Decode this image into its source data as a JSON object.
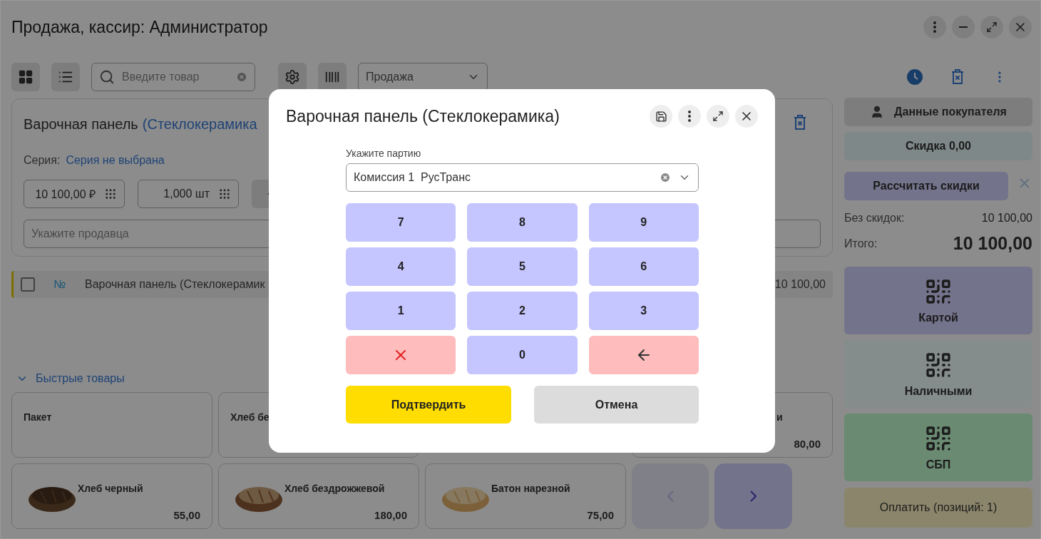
{
  "window": {
    "title": "Продажа, кассир: Администратор"
  },
  "toolbar": {
    "search": {
      "placeholder": "Введите товар"
    },
    "mode_select": {
      "value": "Продажа"
    }
  },
  "item_card": {
    "title": "Варочная панель",
    "title_detail": "(Стеклокерамика",
    "series_label": "Серия:",
    "series_value": "Серия не выбрана",
    "price": "10 100,00 ₽",
    "quantity": "1,000 шт",
    "seller": {
      "placeholder": "Укажите продавца"
    }
  },
  "cart_rows": [
    {
      "checked": false,
      "number": "№",
      "name": "Варочная панель (Стеклокерамик",
      "amount": "10 100,00"
    }
  ],
  "quick_products": {
    "title": "Быстрые товары",
    "expanded": true,
    "items": [
      {
        "kind": "text",
        "name": "Пакет"
      },
      {
        "kind": "text",
        "name": "Хлеб бе"
      },
      {
        "kind": "clipped",
        "name": "и",
        "price": "80,00"
      },
      {
        "kind": "picture",
        "name": "Хлеб черный",
        "price": "55,00"
      },
      {
        "kind": "picture",
        "name": "Хлеб бездрожжевой",
        "price": "180,00"
      },
      {
        "kind": "picture",
        "name": "Батон нарезной",
        "price": "75,00"
      }
    ],
    "nav": [
      {
        "kind": "prev",
        "disabled": true
      },
      {
        "kind": "next",
        "disabled": false
      }
    ]
  },
  "sidebar": {
    "customer_button": "Данные покупателя",
    "discount": "Скидка 0,00",
    "calc_button": "Рассчитать скидки",
    "totals": [
      {
        "kind": "normal",
        "label": "Без скидок:",
        "value": "10 100,00"
      },
      {
        "kind": "total",
        "label": "Итого:",
        "value": "10 100,00"
      }
    ],
    "payments": [
      {
        "kind": "card",
        "label": "Картой"
      },
      {
        "kind": "cash",
        "label": "Наличными"
      },
      {
        "kind": "sbp",
        "label": "СБП"
      }
    ],
    "pay_button": "Оплатить (позиций: 1)"
  },
  "dialog": {
    "title": "Варочная панель (Стеклокерамика)",
    "field_label": "Укажите партию",
    "field_value": "Комиссия 1  РусТранс",
    "keys": [
      {
        "kind": "digit",
        "label": "7"
      },
      {
        "kind": "digit",
        "label": "8"
      },
      {
        "kind": "digit",
        "label": "9"
      },
      {
        "kind": "digit",
        "label": "4"
      },
      {
        "kind": "digit",
        "label": "5"
      },
      {
        "kind": "digit",
        "label": "6"
      },
      {
        "kind": "digit",
        "label": "1"
      },
      {
        "kind": "digit",
        "label": "2"
      },
      {
        "kind": "digit",
        "label": "3"
      },
      {
        "kind": "clear"
      },
      {
        "kind": "digit",
        "label": "0"
      },
      {
        "kind": "backspace"
      }
    ],
    "actions": [
      {
        "kind": "primary",
        "label": "Подтвердить"
      },
      {
        "kind": "secondary",
        "label": "Отмена"
      }
    ]
  }
}
